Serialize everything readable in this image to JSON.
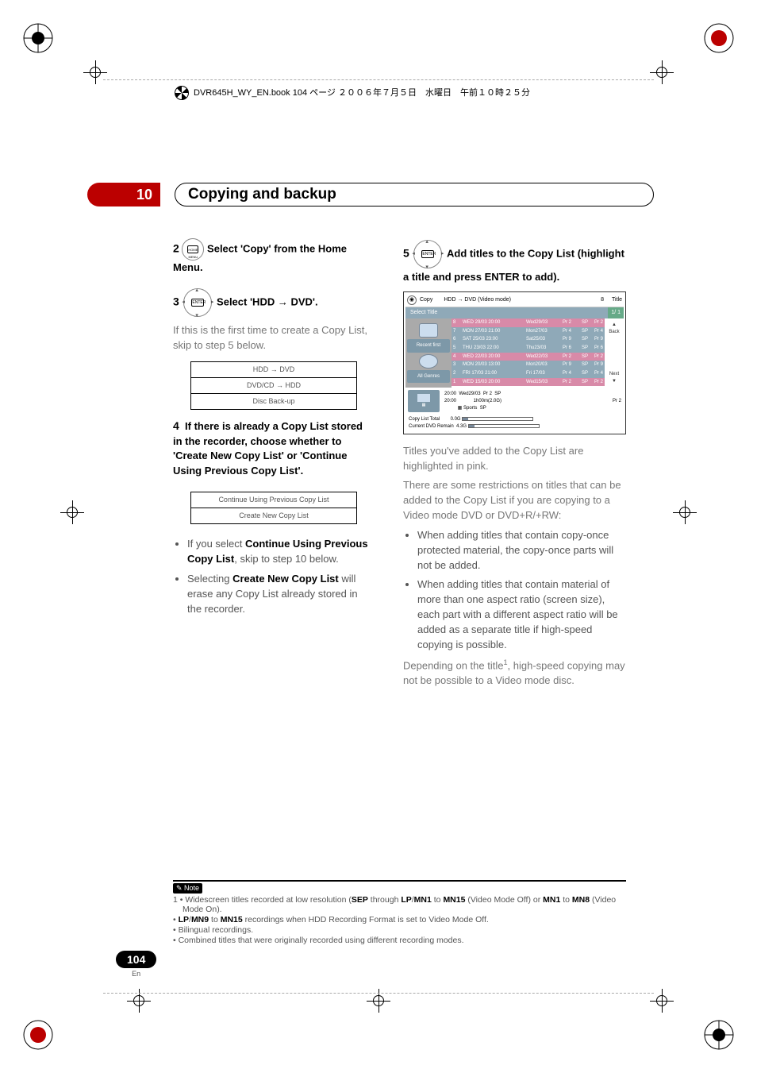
{
  "book_info": "DVR645H_WY_EN.book  104 ページ  ２００６年７月５日　水曜日　午前１０時２５分",
  "chapter": {
    "number": "10",
    "title": "Copying and backup"
  },
  "left_col": {
    "step2": {
      "num": "2",
      "icon_label": "HOME MENU",
      "text": "Select 'Copy' from the Home Menu."
    },
    "step3": {
      "num": "3",
      "icon_label": "ENTER",
      "text": "Select 'HDD → DVD'."
    },
    "step3_sub": "If this is the first time to create a Copy List, skip to step 5 below.",
    "copybox": {
      "r1": "HDD → DVD",
      "r2": "DVD/CD → HDD",
      "r3": "Disc Back-up"
    },
    "step4": {
      "num": "4",
      "text": "If there is already a Copy List stored in the recorder, choose whether to 'Create New Copy List' or 'Continue Using Previous Copy List'."
    },
    "choicebox": {
      "r1": "Continue Using Previous Copy List",
      "r2": "Create New Copy List"
    },
    "bul1_a": "If you select ",
    "bul1_b": "Continue Using Previous Copy List",
    "bul1_c": ", skip to step 10 below.",
    "bul2_a": "Selecting ",
    "bul2_b": "Create New Copy List",
    "bul2_c": " will erase any Copy List already stored in the recorder."
  },
  "right_col": {
    "step5": {
      "num": "5",
      "icon_label": "ENTER",
      "text": "Add titles to the Copy List (highlight a title and press ENTER to add)."
    },
    "screenshot": {
      "hdr_copy": "Copy",
      "hdr_mode": "HDD → DVD (Video mode)",
      "hdr_count": "8",
      "hdr_title": "Title",
      "tab_select": "Select Title",
      "tab_page": "1/ 1",
      "side_recent": "Recent first",
      "side_all": "All Genres",
      "rnav_back": "Back",
      "rnav_next": "Next",
      "rows": [
        {
          "n": "8",
          "a": "WED 29/03 20:00",
          "b": "Wed29/03",
          "c": "Pr 2",
          "d": "SP",
          "e": "Pr 2",
          "hl": true
        },
        {
          "n": "7",
          "a": "MON 27/03 21:00",
          "b": "Mon27/03",
          "c": "Pr 4",
          "d": "SP",
          "e": "Pr 4",
          "hl": false
        },
        {
          "n": "6",
          "a": "SAT 25/03 23:00",
          "b": "Sat25/03",
          "c": "Pr 9",
          "d": "SP",
          "e": "Pr 9",
          "hl": false
        },
        {
          "n": "5",
          "a": "THU 23/03 22:00",
          "b": "Thu23/03",
          "c": "Pr 6",
          "d": "SP",
          "e": "Pr 6",
          "hl": false
        },
        {
          "n": "4",
          "a": "WED 22/03 20:00",
          "b": "Wed22/03",
          "c": "Pr 2",
          "d": "SP",
          "e": "Pr 2",
          "hl": true
        },
        {
          "n": "3",
          "a": "MON 20/03 13:00",
          "b": "Mon20/03",
          "c": "Pr 9",
          "d": "SP",
          "e": "Pr 9",
          "hl": false
        },
        {
          "n": "2",
          "a": "FRI  17/03 21:00",
          "b": "Fri 17/03",
          "c": "Pr 4",
          "d": "SP",
          "e": "Pr 4",
          "hl": false
        },
        {
          "n": "1",
          "a": "WED 15/03 20:00",
          "b": "Wed15/03",
          "c": "Pr 2",
          "d": "SP",
          "e": "Pr 2",
          "hl": true
        }
      ],
      "detail": {
        "t1": "20:00",
        "t2": "20:00",
        "date": "Wed29/03",
        "ch": "Pr 2",
        "mode": "SP",
        "dur": "1h00m(2.0G)",
        "genre": "Sports",
        "mode2": "SP",
        "right": "Pr 2"
      },
      "stats": {
        "l1": "Copy List Total",
        "v1": "0.0G",
        "l2": "Current DVD Remain",
        "v2": "4.3G"
      }
    },
    "p1": "Titles you've added to the Copy List are highlighted in pink.",
    "p2": "There are some restrictions on titles that can be added to the Copy List if you are copying to a Video mode DVD or DVD+R/+RW:",
    "bul1": "When adding titles that contain copy-once protected material, the copy-once parts will not be added.",
    "bul2": "When adding titles that contain material of more than one aspect ratio (screen size), each part with a different aspect ratio will be added as a separate title if high-speed copying is possible.",
    "p3a": "Depending on the title",
    "p3sup": "1",
    "p3b": ", high-speed copying may not be possible to a Video mode disc."
  },
  "note": {
    "label": "Note",
    "n1a": "1 • Widescreen titles recorded at low resolution (",
    "n1b": "SEP",
    "n1c": " through ",
    "n1d": "LP",
    "n1e": "/",
    "n1f": "MN1",
    "n1g": " to ",
    "n1h": "MN15",
    "n1i": " (Video Mode Off) or ",
    "n1j": "MN1",
    "n1k": " to ",
    "n1l": "MN8",
    "n1m": " (Video Mode On).",
    "n2a": "• ",
    "n2b": "LP",
    "n2c": "/",
    "n2d": "MN9",
    "n2e": " to ",
    "n2f": "MN15",
    "n2g": " recordings when HDD Recording Format is set to Video Mode Off.",
    "n3": "• Bilingual recordings.",
    "n4": "• Combined titles that were originally recorded using different recording modes."
  },
  "page": {
    "num": "104",
    "lang": "En"
  }
}
